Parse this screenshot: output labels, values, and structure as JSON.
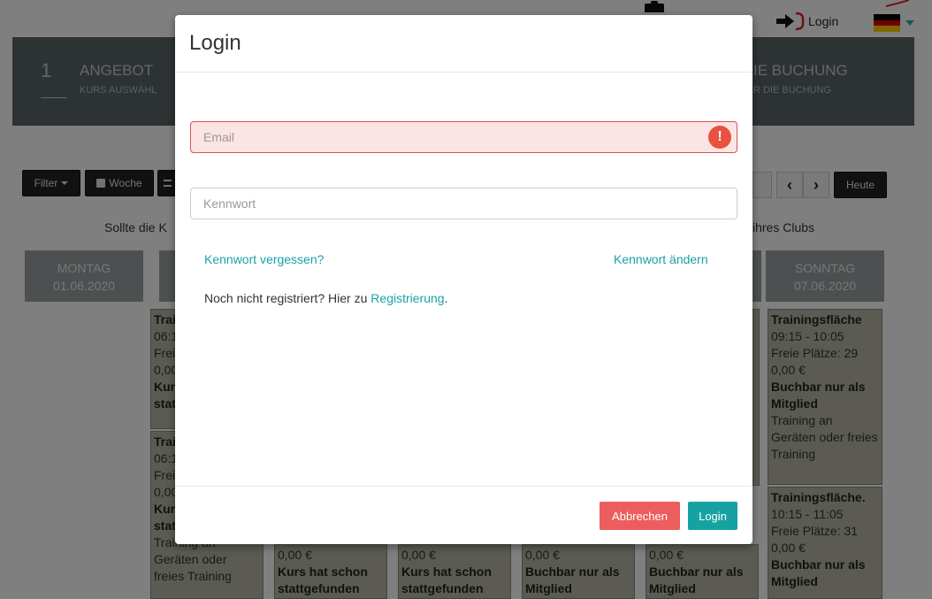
{
  "topbar": {
    "login_label": "Login",
    "flag": [
      "#000000",
      "#dd0000",
      "#ffce00"
    ]
  },
  "wizard": {
    "step1": {
      "number": "1",
      "title": "ANGEBOT",
      "subtitle": "KURS AUSWÄHL"
    },
    "step3": {
      "title": "IE BUCHUNG",
      "subtitle": "R DIE BUCHUNG"
    }
  },
  "toolbar": {
    "filter_label": "Filter",
    "week_label": "Woche",
    "today_label": "Heute",
    "prev": "‹",
    "next": "›"
  },
  "notice": {
    "left": "Sollte die K",
    "right": "ihres Clubs"
  },
  "days": [
    {
      "name": "MONTAG",
      "date": "01.06.2020"
    },
    {
      "name": "SONNTAG",
      "date": "07.06.2020"
    }
  ],
  "cards": {
    "sunday_1": {
      "title": "Trainingsfläche",
      "time": "09:15 - 10:05",
      "free": "Freie Plätze: 29",
      "price": "0,00 €",
      "status": "Buchbar nur als Mitglied",
      "desc": "Training an Geräten oder freies Training"
    },
    "sunday_2": {
      "title": "Trainingsfläche.",
      "time": "10:15 - 11:05",
      "free": "Freie Plätze: 31",
      "price": "0,00 €",
      "status": "Buchbar nur als Mitglied"
    },
    "tue_a": {
      "l1": "Trai",
      "l2": "06:1",
      "l3": "Frei",
      "l4": "0,00",
      "l5": "Kur",
      "l6": "stat"
    },
    "tue_b": {
      "l1": "Trai",
      "l2": "06:1",
      "l3": "Frei",
      "l4": "0,00",
      "l5": "Kur",
      "l6": "stat",
      "desc": "Training an Geräten oder freies Training"
    },
    "wed": {
      "price": "0,00 €",
      "status": "Kurs hat schon stattgefunden"
    },
    "thu": {
      "price": "0,00 €",
      "status": "Kurs hat schon stattgefunden"
    },
    "fri": {
      "price": "0,00 €",
      "status": "Buchbar nur als Mitglied"
    },
    "sat": {
      "price": "0,00 €",
      "status": "Buchbar nur als Mitglied"
    }
  },
  "modal": {
    "title": "Login",
    "email_placeholder": "Email",
    "password_placeholder": "Kennwort",
    "forgot_link": "Kennwort vergessen?",
    "change_link": "Kennwort ändern",
    "register_prefix": "Noch nicht registriert? Hier zu ",
    "register_link": "Registrierung",
    "register_suffix": ".",
    "cancel_label": "Abbrechen",
    "login_label": "Login",
    "error_glyph": "!"
  }
}
